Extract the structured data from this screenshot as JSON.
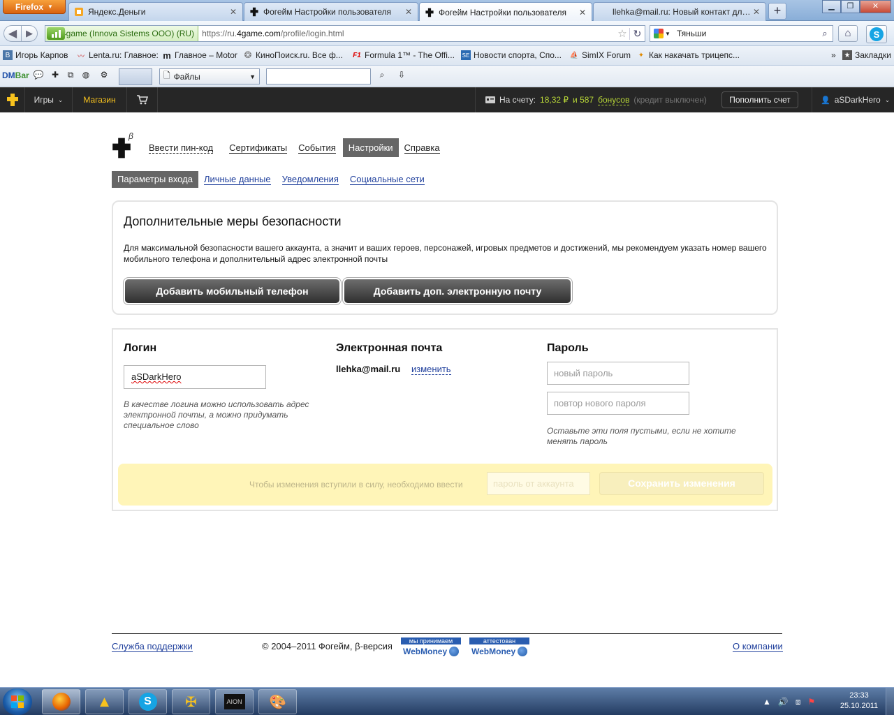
{
  "browser": {
    "menu_label": "Firefox",
    "tabs": [
      {
        "title": "Яндекс.Деньги",
        "active": false
      },
      {
        "title": "Фогейм Настройки пользователя",
        "active": false
      },
      {
        "title": "Фогейм Настройки пользователя",
        "active": true
      },
      {
        "title": "llehka@mail.ru: Новый контакт для ...",
        "active": false
      }
    ],
    "identity_label": "4game (Innova Sistems OOO) (RU)",
    "url_prefix": "https://ru.",
    "url_domain": "4game.com",
    "url_path": "/profile/login.html",
    "search_value": "Тяньши",
    "bookmarks": [
      "Игорь Карпов",
      "Lenta.ru: Главное:",
      "Главное – Motor",
      "КиноПоиск.ru. Все ф...",
      "Formula 1™ - The Offi...",
      "Новости спорта, Спо...",
      "SimIX Forum",
      "Как накачать трицепс..."
    ],
    "bookmarks_more": "»",
    "bookmarks_folder": "Закладки",
    "dmbar_logo_d": "DM",
    "dmbar_logo_b": "Bar",
    "dmbar_files": "Файлы"
  },
  "site": {
    "games_label": "Игры",
    "shop_label": "Магазин",
    "balance_label": "На счету:",
    "balance_amount": "18,32 ₽",
    "balance_and": "и 587",
    "balance_bonus": "бонусов",
    "credit_label": "(кредит выключен)",
    "topup_label": "Пополнить счет",
    "username": "aSDarkHero"
  },
  "page": {
    "beta_mark": "β",
    "main_nav": [
      {
        "label": "Ввести пин-код",
        "style": "dash"
      },
      {
        "label": "Сертификаты",
        "style": "line"
      },
      {
        "label": "События",
        "style": "line"
      },
      {
        "label": "Настройки",
        "style": "active"
      },
      {
        "label": "Справка",
        "style": "line"
      }
    ],
    "sub_nav": [
      {
        "label": "Параметры входа",
        "active": true
      },
      {
        "label": "Личные данные",
        "active": false
      },
      {
        "label": "Уведомления",
        "active": false
      },
      {
        "label": "Социальные сети",
        "active": false
      }
    ],
    "security": {
      "title": "Дополнительные меры безопасности",
      "text": "Для максимальной безопасности вашего аккаунта, а значит и ваших героев, персонажей, игровых предметов и достижений, мы рекомендуем указать номер вашего мобильного телефона и дополнительный адрес электронной почты",
      "add_phone": "Добавить мобильный телефон",
      "add_email": "Добавить доп. электронную почту"
    },
    "login": {
      "heading": "Логин",
      "value": "aSDarkHero",
      "hint": "В качестве логина можно использовать адрес электронной почты, а можно придумать специальное слово"
    },
    "email": {
      "heading": "Электронная почта",
      "value": "llehka@mail.ru",
      "change": "изменить"
    },
    "password": {
      "heading": "Пароль",
      "new_placeholder": "новый пароль",
      "repeat_placeholder": "повтор нового пароля",
      "hint": "Оставьте эти поля пустыми, если не хотите менять пароль"
    },
    "save": {
      "text": "Чтобы изменения вступили в силу, необходимо ввести",
      "pw_placeholder": "пароль от аккаунта",
      "button": "Сохранить изменения"
    }
  },
  "footer": {
    "support": "Служба поддержки",
    "copyright": "© 2004–2011 Фогейм, β-версия",
    "wm1_top": "мы принимаем",
    "wm2_top": "аттестован",
    "wm_name": "WebMoney",
    "about": "О компании"
  },
  "taskbar": {
    "time": "23:33",
    "date": "25.10.2011"
  }
}
